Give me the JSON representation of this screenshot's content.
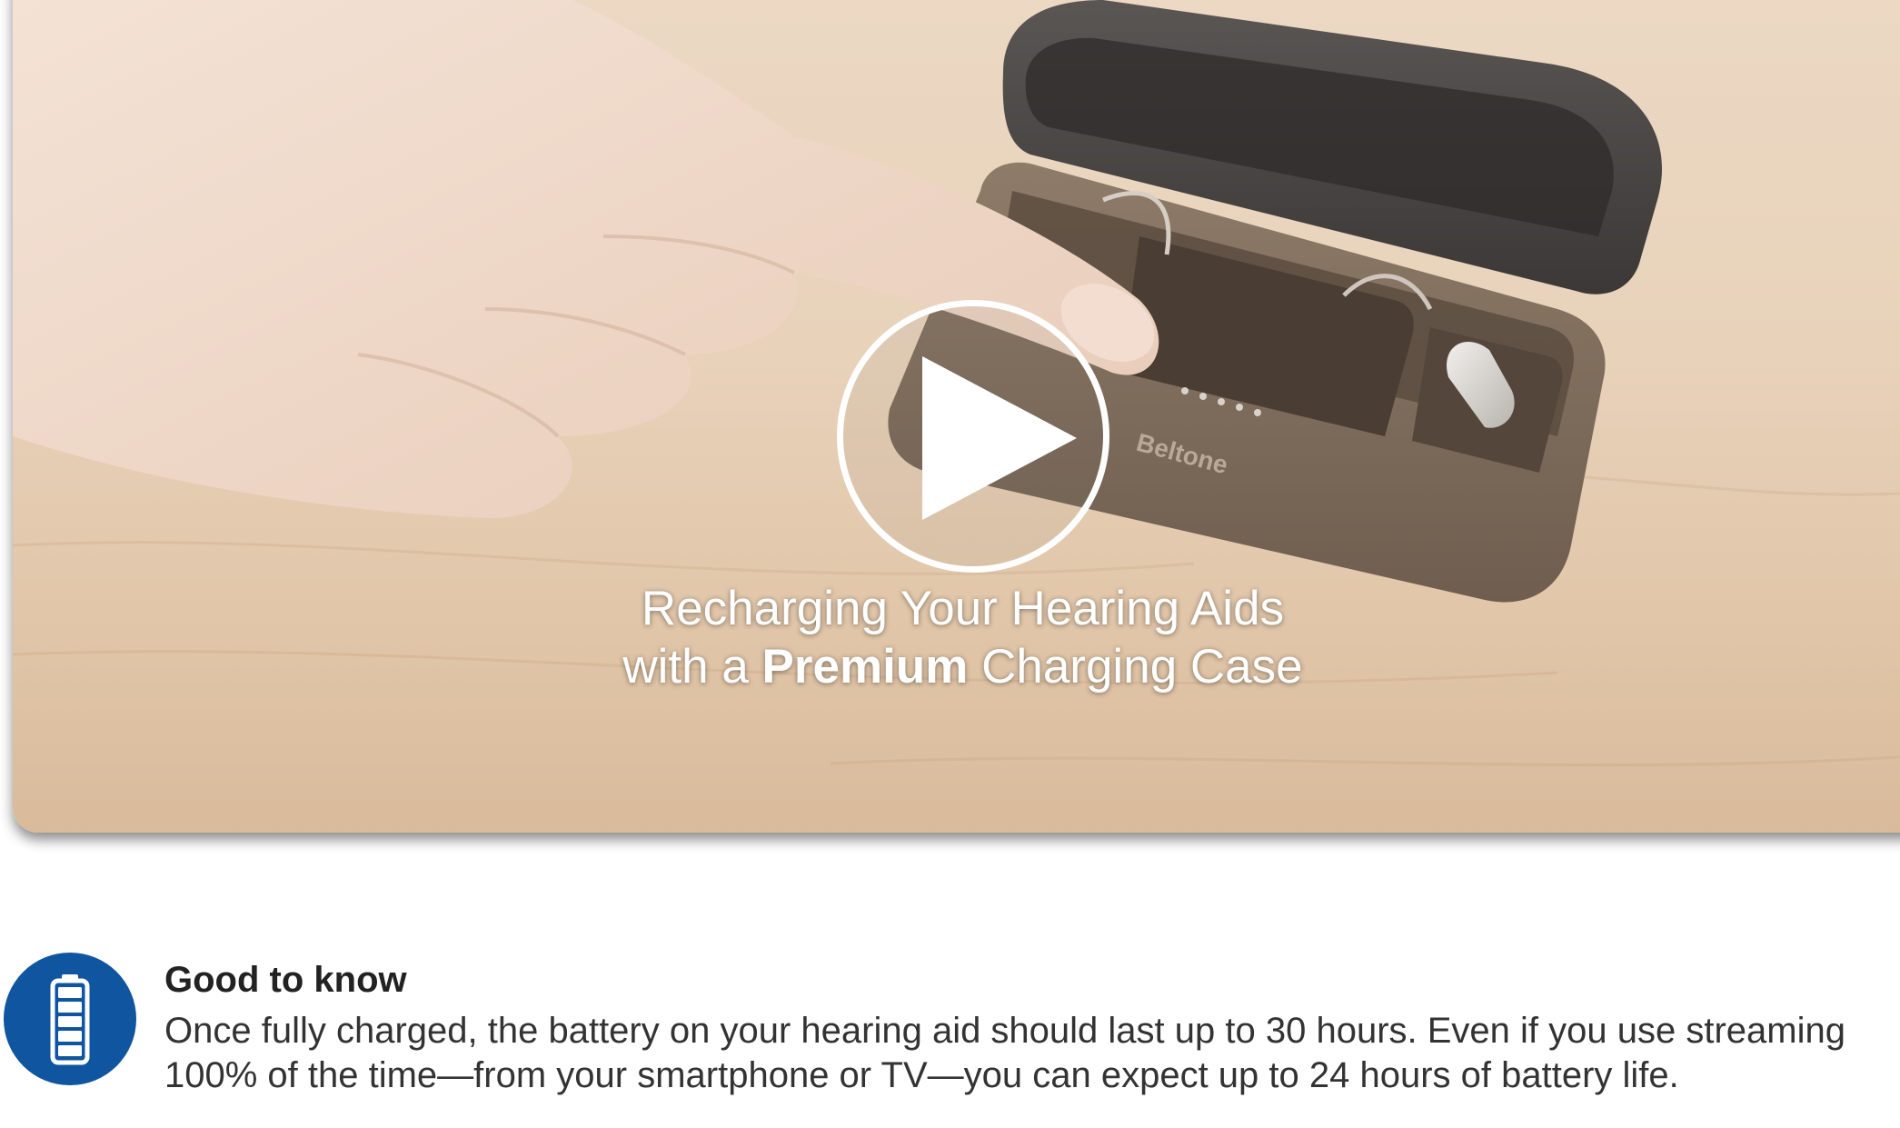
{
  "video": {
    "caption_line1": "Recharging Your Hearing Aids",
    "caption_line2_pre": "with a ",
    "caption_line2_bold": "Premium",
    "caption_line2_post": " Charging Case",
    "case_brand_text": "Beltone",
    "play_icon": "play-icon"
  },
  "info": {
    "icon": "battery-icon",
    "icon_color": "#0f55a0",
    "title": "Good to know",
    "body_line1": "Once fully charged, the battery on your hearing aid should last up to 30 hours. Even if you use streaming",
    "body_line2": "100% of the time—from your smartphone or TV—you can expect up to 24 hours of battery life."
  }
}
